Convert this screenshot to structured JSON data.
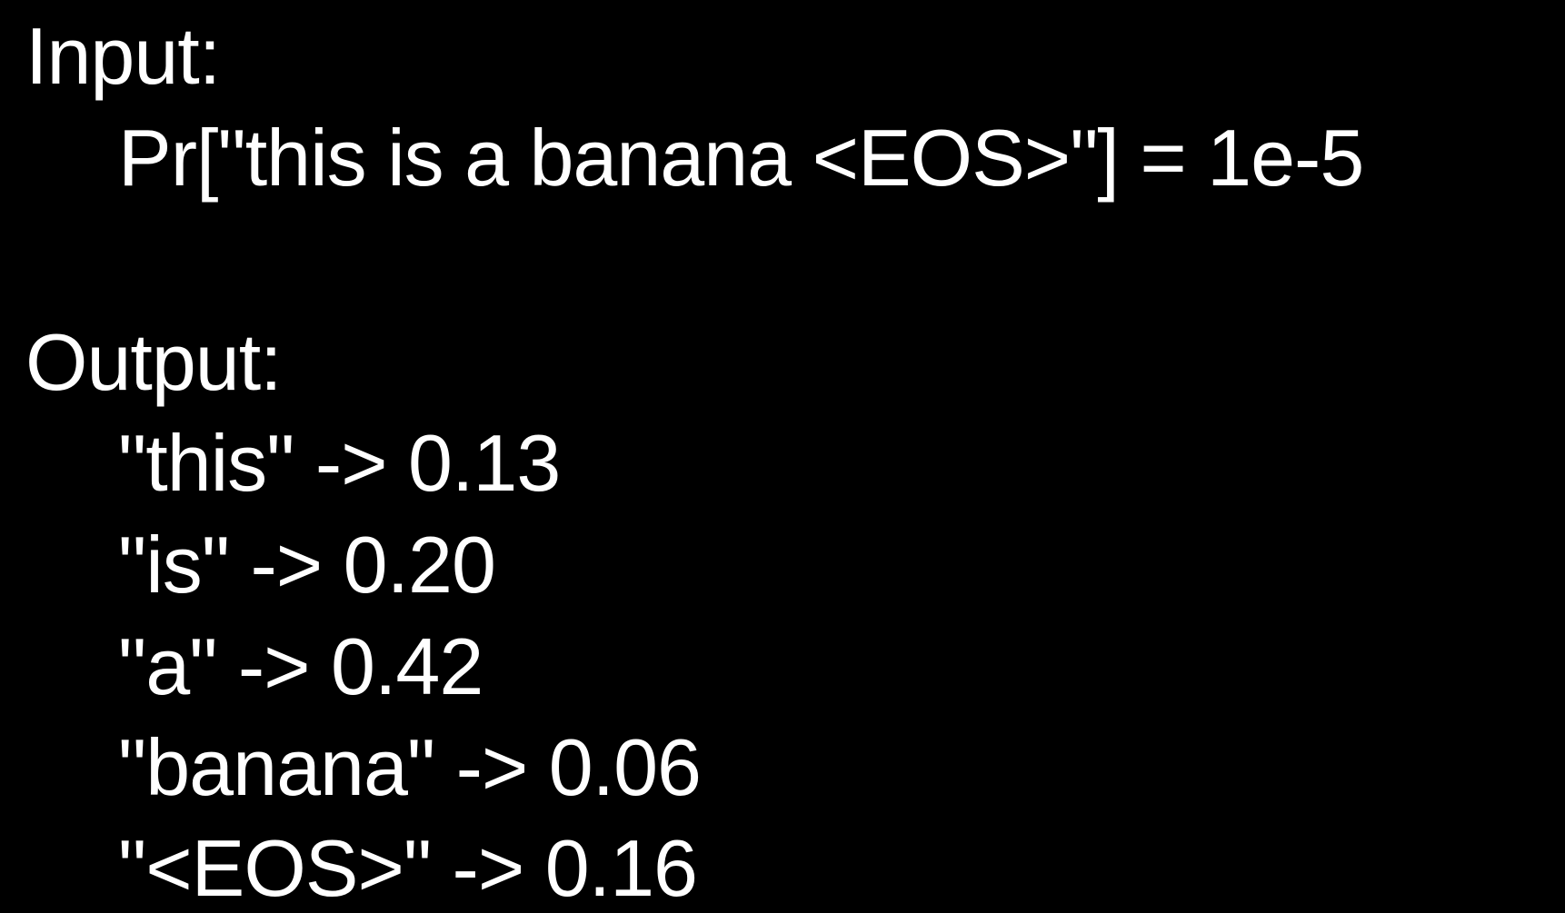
{
  "input": {
    "heading": "Input:",
    "expression": "Pr[\"this is a banana <EOS>\"] = 1e-5"
  },
  "output": {
    "heading": "Output:",
    "items": [
      "\"this\" -> 0.13",
      "\"is\" -> 0.20",
      "\"a\" -> 0.42",
      "\"banana\" -> 0.06",
      "\"<EOS>\" -> 0.16"
    ]
  },
  "colors": {
    "background": "#000000",
    "text": "#ffffff"
  }
}
